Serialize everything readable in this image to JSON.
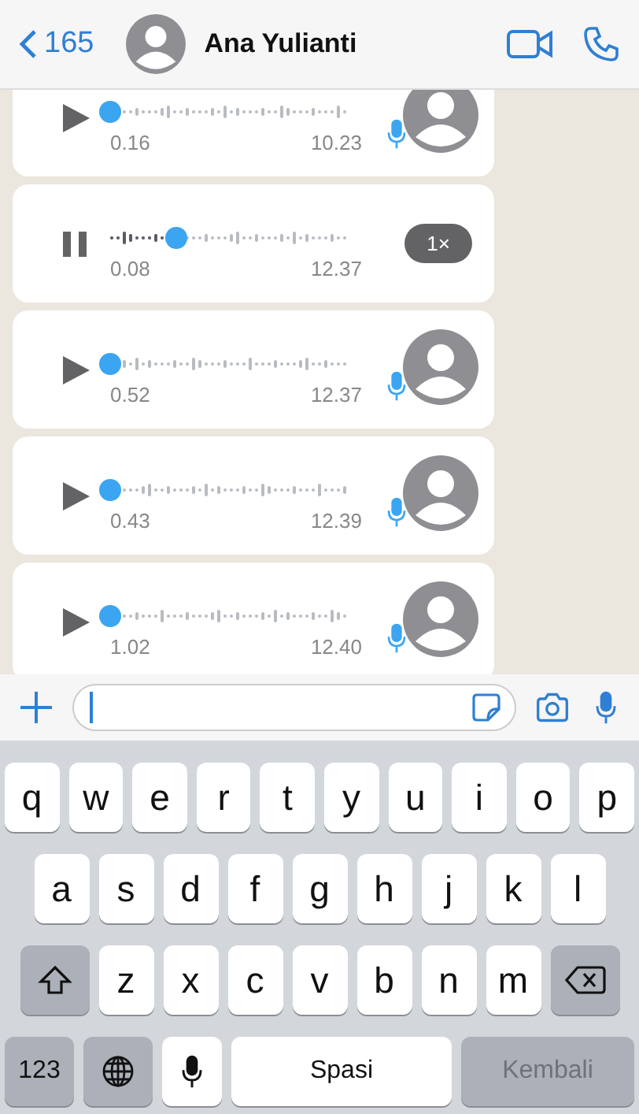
{
  "header": {
    "back_label": "165",
    "contact_name": "Ana Yulianti"
  },
  "messages": [
    {
      "playing": false,
      "elapsed": "0.16",
      "duration": "10.23"
    },
    {
      "playing": true,
      "level": 0.27,
      "elapsed": "0.08",
      "duration": "12.37",
      "speed": "1×"
    },
    {
      "playing": false,
      "elapsed": "0.52",
      "duration": "12.37"
    },
    {
      "playing": false,
      "elapsed": "0.43",
      "duration": "12.39"
    },
    {
      "playing": false,
      "elapsed": "1.02",
      "duration": "12.40"
    }
  ],
  "keyboard": {
    "rows": [
      {
        "keys": [
          {
            "kind": "letter",
            "label": "q"
          },
          {
            "kind": "letter",
            "label": "w"
          },
          {
            "kind": "letter",
            "label": "e"
          },
          {
            "kind": "letter",
            "label": "r"
          },
          {
            "kind": "letter",
            "label": "t"
          },
          {
            "kind": "letter",
            "label": "y"
          },
          {
            "kind": "letter",
            "label": "u"
          },
          {
            "kind": "letter",
            "label": "i"
          },
          {
            "kind": "letter",
            "label": "o"
          },
          {
            "kind": "letter",
            "label": "p"
          }
        ]
      },
      {
        "keys": [
          {
            "kind": "letter",
            "label": "a"
          },
          {
            "kind": "letter",
            "label": "s"
          },
          {
            "kind": "letter",
            "label": "d"
          },
          {
            "kind": "letter",
            "label": "f"
          },
          {
            "kind": "letter",
            "label": "g"
          },
          {
            "kind": "letter",
            "label": "h"
          },
          {
            "kind": "letter",
            "label": "j"
          },
          {
            "kind": "letter",
            "label": "k"
          },
          {
            "kind": "letter",
            "label": "l"
          }
        ]
      },
      {
        "keys": [
          {
            "kind": "shift"
          },
          {
            "kind": "letter",
            "label": "z"
          },
          {
            "kind": "letter",
            "label": "x"
          },
          {
            "kind": "letter",
            "label": "c"
          },
          {
            "kind": "letter",
            "label": "v"
          },
          {
            "kind": "letter",
            "label": "b"
          },
          {
            "kind": "letter",
            "label": "n"
          },
          {
            "kind": "letter",
            "label": "m"
          },
          {
            "kind": "delete"
          }
        ]
      },
      {
        "keys": [
          {
            "kind": "numbers",
            "label": "123"
          },
          {
            "kind": "globe"
          },
          {
            "kind": "dictation"
          },
          {
            "kind": "space",
            "label": "Spasi"
          },
          {
            "kind": "return",
            "label": "Kembali",
            "disabled": true
          }
        ]
      }
    ]
  }
}
